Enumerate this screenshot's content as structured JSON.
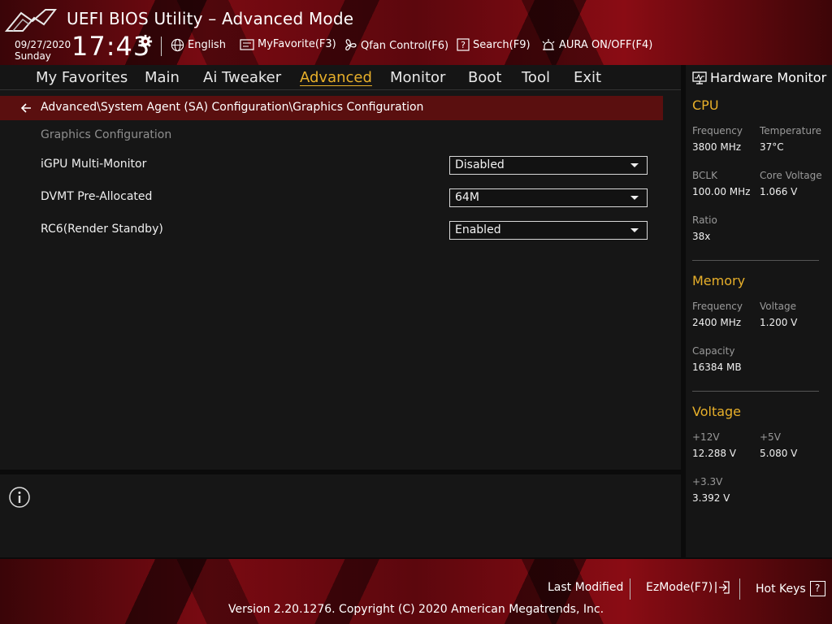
{
  "window": {
    "title": "UEFI BIOS Utility – Advanced Mode"
  },
  "clock": {
    "date": "09/27/2020",
    "day": "Sunday",
    "time": "17:43"
  },
  "toolbar": {
    "language": "English",
    "myfavorite": "MyFavorite(F3)",
    "qfan": "Qfan Control(F6)",
    "search": "Search(F9)",
    "aura": "AURA ON/OFF(F4)"
  },
  "nav": {
    "tabs": [
      "My Favorites",
      "Main",
      "Ai Tweaker",
      "Advanced",
      "Monitor",
      "Boot",
      "Tool",
      "Exit"
    ],
    "active": "Advanced"
  },
  "breadcrumb": "Advanced\\System Agent (SA) Configuration\\Graphics Configuration",
  "section": "Graphics Configuration",
  "settings": [
    {
      "label": "iGPU Multi-Monitor",
      "value": "Disabled"
    },
    {
      "label": "DVMT Pre-Allocated",
      "value": "64M"
    },
    {
      "label": "RC6(Render Standby)",
      "value": "Enabled"
    }
  ],
  "hardware_monitor": {
    "title": "Hardware Monitor",
    "cpu": {
      "heading": "CPU",
      "frequency_label": "Frequency",
      "frequency": "3800 MHz",
      "temperature_label": "Temperature",
      "temperature": "37°C",
      "bclk_label": "BCLK",
      "bclk": "100.00 MHz",
      "core_voltage_label": "Core Voltage",
      "core_voltage": "1.066 V",
      "ratio_label": "Ratio",
      "ratio": "38x"
    },
    "memory": {
      "heading": "Memory",
      "frequency_label": "Frequency",
      "frequency": "2400 MHz",
      "voltage_label": "Voltage",
      "voltage": "1.200 V",
      "capacity_label": "Capacity",
      "capacity": "16384 MB"
    },
    "voltage": {
      "heading": "Voltage",
      "v12_label": "+12V",
      "v12": "12.288 V",
      "v5_label": "+5V",
      "v5": "5.080 V",
      "v33_label": "+3.3V",
      "v33": "3.392 V"
    }
  },
  "footer": {
    "last_modified": "Last Modified",
    "ezmode": "EzMode(F7)",
    "hotkeys": "Hot Keys",
    "hotkeys_key": "?",
    "version": "Version 2.20.1276. Copyright (C) 2020 American Megatrends, Inc."
  },
  "colors": {
    "accent": "#e8b02a",
    "brand_red": "#7a0a12",
    "panel": "#161616"
  }
}
